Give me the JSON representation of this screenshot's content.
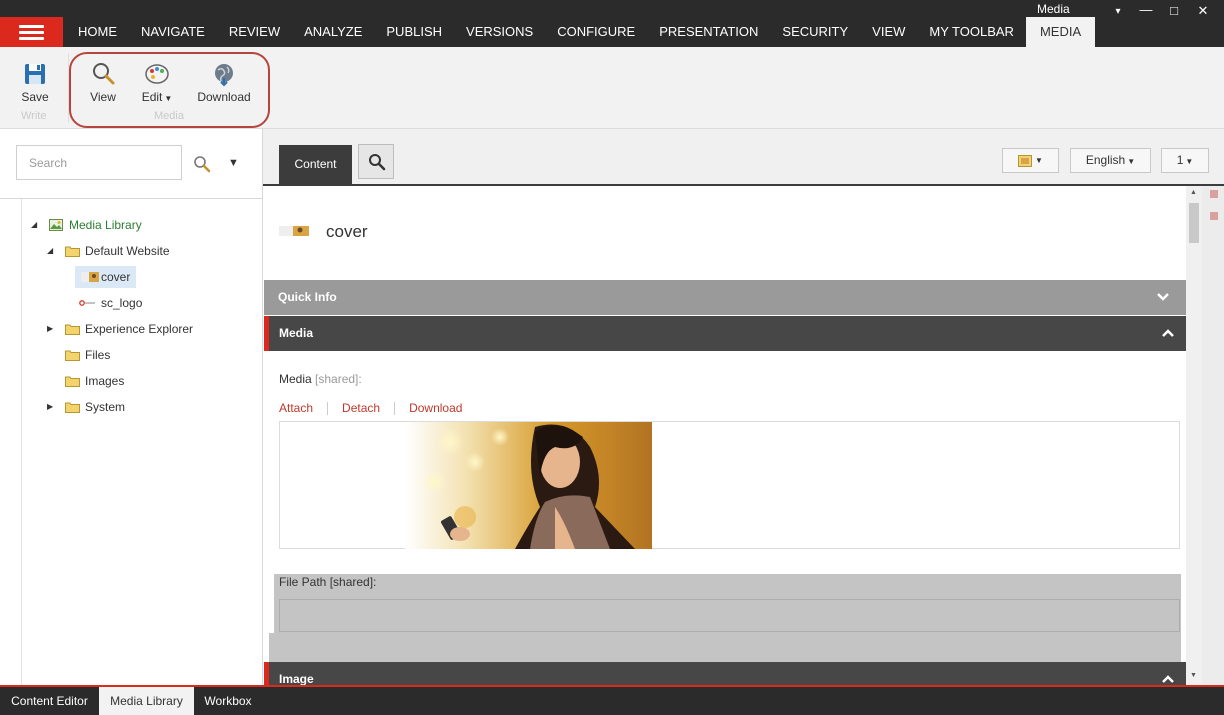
{
  "window": {
    "title": "Media",
    "controls": {
      "minimize": "▾",
      "min": "—",
      "max": "□",
      "close": "✕"
    }
  },
  "menu": {
    "items": [
      "HOME",
      "NAVIGATE",
      "REVIEW",
      "ANALYZE",
      "PUBLISH",
      "VERSIONS",
      "CONFIGURE",
      "PRESENTATION",
      "SECURITY",
      "VIEW",
      "MY TOOLBAR",
      "MEDIA"
    ],
    "active": "MEDIA"
  },
  "ribbon": {
    "save_label": "Save",
    "write_group": "Write",
    "view_label": "View",
    "edit_label": "Edit",
    "download_label": "Download",
    "media_group": "Media"
  },
  "left": {
    "search_placeholder": "Search",
    "tree": {
      "root": "Media Library",
      "default_website": "Default Website",
      "cover": "cover",
      "sc_logo": "sc_logo",
      "experience_explorer": "Experience Explorer",
      "files": "Files",
      "images": "Images",
      "system": "System"
    }
  },
  "editor": {
    "tab_label": "Content",
    "language": "English",
    "version": "1",
    "item_title": "cover",
    "sections": {
      "quick_info": "Quick Info",
      "media": "Media",
      "image": "Image"
    },
    "media_field": {
      "label": "Media",
      "shared": "[shared]:"
    },
    "media_links": {
      "attach": "Attach",
      "detach": "Detach",
      "download": "Download"
    },
    "file_path_label": "File Path [shared]:"
  },
  "bottom_tabs": {
    "content_editor": "Content Editor",
    "media_library": "Media Library",
    "workbox": "Workbox",
    "active": "Media Library"
  },
  "colors": {
    "accent": "#dc291e",
    "topbar": "#2b2b2b",
    "section_dark": "#474747",
    "link": "#c0392b"
  }
}
